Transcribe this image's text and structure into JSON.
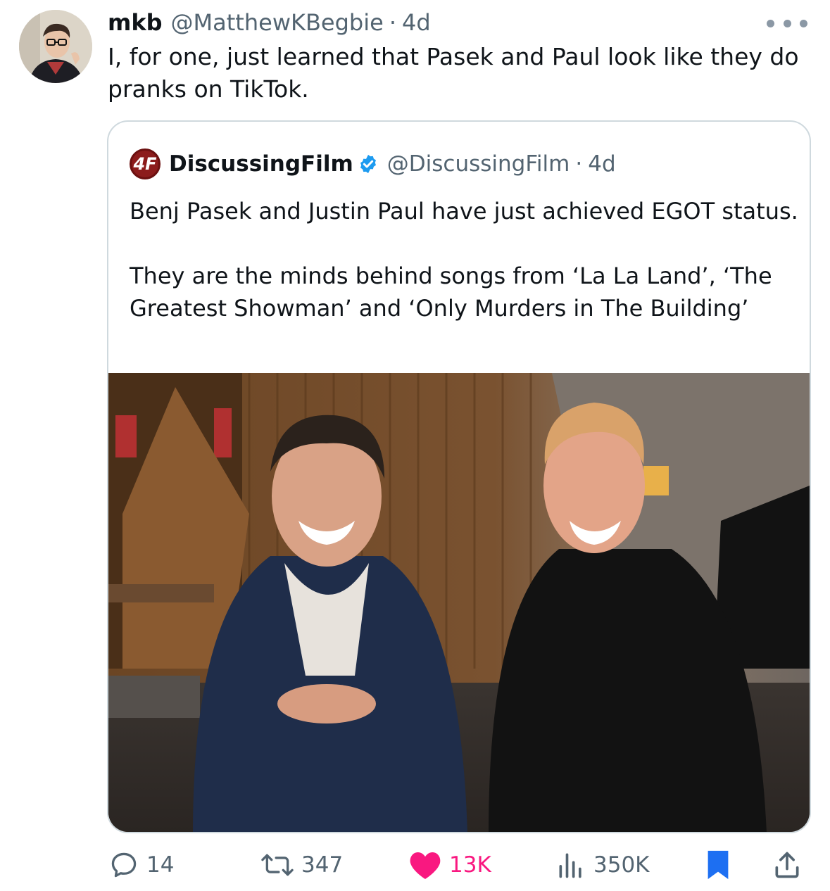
{
  "tweet": {
    "display_name": "mkb",
    "handle": "@MatthewKBegbie",
    "separator": "·",
    "age": "4d",
    "text": "I, for one, just learned that Pasek and Paul look like they do pranks on TikTok."
  },
  "quoted_tweet": {
    "logo_text": "4F",
    "display_name": "DiscussingFilm",
    "handle": "@DiscussingFilm",
    "separator": "·",
    "age": "4d",
    "text": "Benj Pasek and Justin Paul have just achieved EGOT status.\n\nThey are the minds behind songs from ‘La La Land’, ‘The Greatest Showman’ and ‘Only Murders in The Building’",
    "verified_color": "#1d9bf0",
    "logo_color": "#8c1c1c"
  },
  "actions": {
    "replies": "14",
    "reposts": "347",
    "likes": "13K",
    "views": "350K",
    "liked_color": "#f91880"
  },
  "icons": {
    "more": "more-dots-icon",
    "reply": "reply-bubble-icon",
    "repost": "repost-arrows-icon",
    "like": "heart-icon",
    "views": "views-bar-chart-icon",
    "bookmark": "bookmark-icon",
    "share": "share-upload-icon"
  }
}
